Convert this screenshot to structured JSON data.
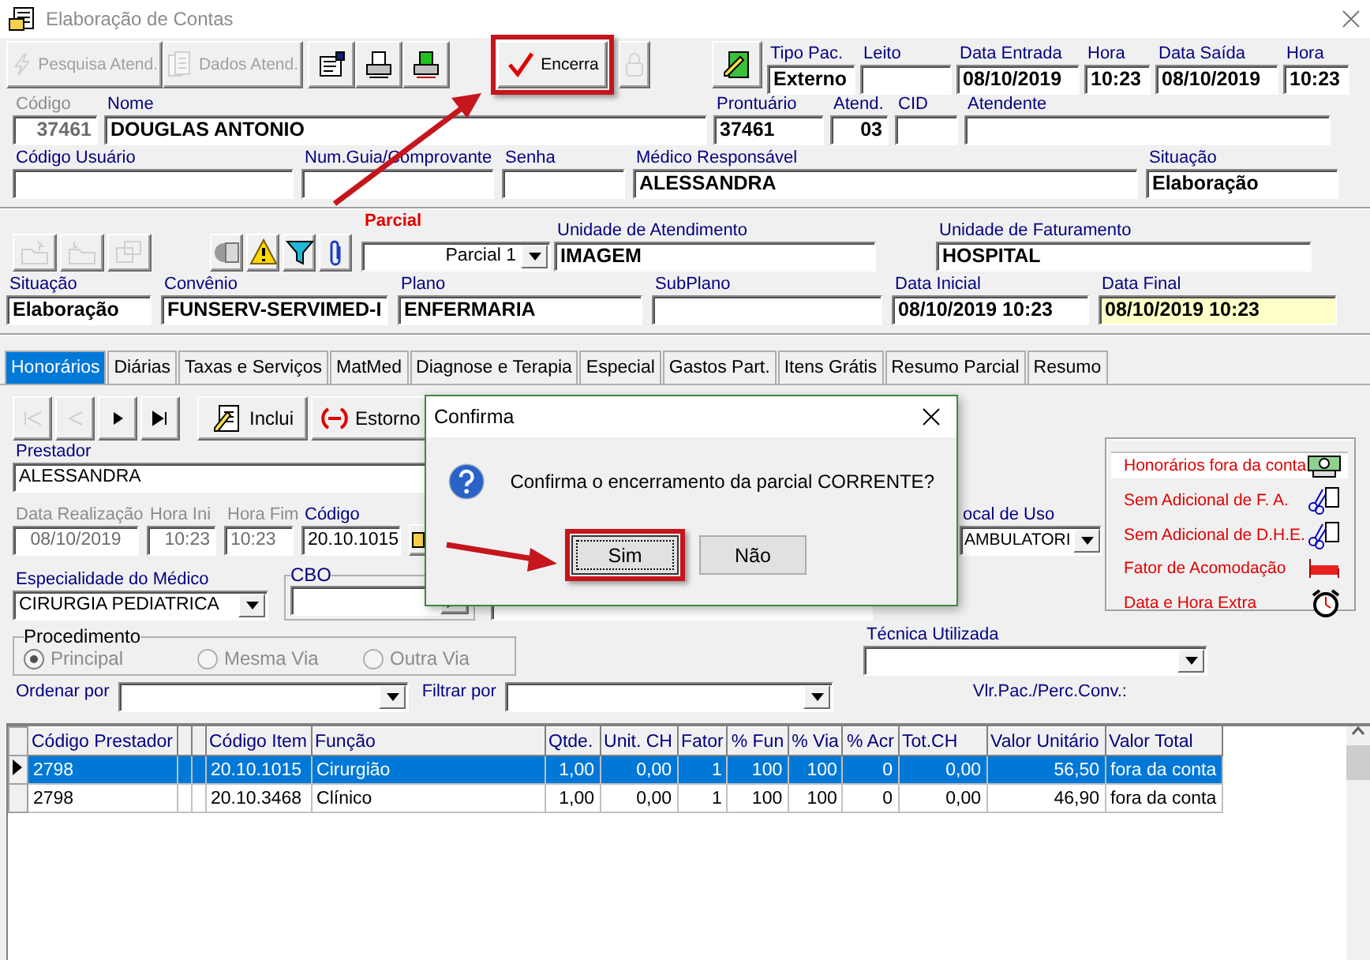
{
  "window": {
    "title": "Elaboração de Contas"
  },
  "toolbar": [
    {
      "kind": "search",
      "label": "Pesquisa Atend.",
      "disabled": true
    },
    {
      "kind": "documents",
      "label": "Dados Atend.",
      "disabled": true
    },
    {
      "kind": "properties",
      "disabled": false
    },
    {
      "kind": "printer",
      "disabled": false
    },
    {
      "kind": "printer-green",
      "disabled": false
    },
    {
      "kind": "check",
      "label": "Encerra",
      "disabled": false,
      "highlighted": true
    },
    {
      "kind": "lock",
      "disabled": true
    },
    {
      "kind": "edit-doc",
      "disabled": false
    }
  ],
  "header_rows": [
    [
      {
        "label": "Tipo Pac.",
        "value": "Externo"
      },
      {
        "label": "Leito"
      },
      {
        "label": "Data Entrada",
        "value": "08/10/2019"
      },
      {
        "label": "Hora",
        "value": "10:23"
      },
      {
        "label": "Data Saída",
        "value": "08/10/2019"
      },
      {
        "label": "Hora",
        "value": "10:23"
      }
    ],
    [
      {
        "label": "Código",
        "value": "37461",
        "disabled": true
      },
      {
        "label": "Nome",
        "value": "DOUGLAS ANTONIO",
        "disabled": false
      },
      {
        "label": "Prontuário",
        "value": "37461",
        "disabled": false
      },
      {
        "label": "Atend.",
        "value": "03",
        "disabled": false
      },
      {
        "label": "CID",
        "disabled": false
      },
      {
        "label": "Atendente",
        "disabled": false
      }
    ],
    [
      {
        "label": "Código Usuário"
      },
      {
        "label": "Num.Guia/Comprovante"
      },
      {
        "label": "Senha"
      },
      {
        "label": "Médico Responsável",
        "value": "ALESSANDRA"
      },
      {
        "label": "Situação",
        "value": "Elaboração"
      }
    ]
  ],
  "partial_tools": [
    {
      "kind": "folder-up",
      "disabled": true
    },
    {
      "kind": "folder-down",
      "disabled": true
    },
    {
      "kind": "windows",
      "disabled": true
    },
    {
      "kind": "gear-doc",
      "disabled": false
    },
    {
      "kind": "warning",
      "disabled": false
    },
    {
      "kind": "filter",
      "disabled": false
    },
    {
      "kind": "paperclip",
      "disabled": false
    }
  ],
  "parcial": {
    "label": "Parcial",
    "value": "Parcial 1"
  },
  "unidades": [
    {
      "label": "Unidade de Atendimento",
      "value": "IMAGEM"
    },
    {
      "label": "Unidade de Faturamento",
      "value": "HOSPITAL"
    }
  ],
  "account_row": [
    {
      "label": "Situação",
      "value": "Elaboração",
      "focused": false
    },
    {
      "label": "Convênio",
      "value": "FUNSERV-SERVIMED-I",
      "focused": false
    },
    {
      "label": "Plano",
      "value": "ENFERMARIA",
      "focused": false
    },
    {
      "label": "SubPlano",
      "focused": false
    },
    {
      "label": "Data Inicial",
      "value": "08/10/2019 10:23",
      "focused": false
    },
    {
      "label": "Data Final",
      "value": "08/10/2019 10:23",
      "focused": true
    }
  ],
  "tabs": [
    {
      "label": "Honorários",
      "selected": true
    },
    {
      "label": "Diárias",
      "selected": false
    },
    {
      "label": "Taxas e Serviços",
      "selected": false
    },
    {
      "label": "MatMed",
      "selected": false
    },
    {
      "label": "Diagnose e Terapia",
      "selected": false
    },
    {
      "label": "Especial",
      "selected": false
    },
    {
      "label": "Gastos Part.",
      "selected": false
    },
    {
      "label": "Itens Grátis",
      "selected": false
    },
    {
      "label": "Resumo Parcial",
      "selected": false
    },
    {
      "label": "Resumo",
      "selected": false
    }
  ],
  "nav": [
    {
      "kind": "first",
      "disabled": true
    },
    {
      "kind": "prev",
      "disabled": true
    },
    {
      "kind": "next",
      "disabled": false
    },
    {
      "kind": "last",
      "disabled": false
    },
    {
      "kind": "add",
      "label": "Inclui",
      "disabled": false
    },
    {
      "kind": "reverse",
      "label": "Estorno",
      "disabled": false
    }
  ],
  "prestador": {
    "label": "Prestador",
    "value": "ALESSANDRA"
  },
  "date_row": [
    {
      "label": "Data Realização",
      "value": "08/10/2019",
      "disabled": true
    },
    {
      "label": "Hora Ini",
      "value": "10:23",
      "disabled": true
    },
    {
      "label": "Hora Fim",
      "value": "10:23",
      "disabled": true
    },
    {
      "label": "Código",
      "value": "20.10.1015",
      "disabled": false
    }
  ],
  "local_de_uso": {
    "label": "ocal de Uso",
    "value": "AMBULATORI"
  },
  "especialidade": {
    "label": "Especialidade do Médico",
    "value": "CIRURGIA PEDIATRICA"
  },
  "cbo": {
    "label": "CBO"
  },
  "procedimento": {
    "label": "Procedimento",
    "disabled": true,
    "options": [
      {
        "label": "Principal",
        "selected": true
      },
      {
        "label": "Mesma Via",
        "selected": false
      },
      {
        "label": "Outra Via",
        "selected": false
      }
    ]
  },
  "tecnica": {
    "label": "Técnica Utilizada"
  },
  "ordenar": {
    "label": "Ordenar por"
  },
  "filtrar": {
    "label": "Filtrar por"
  },
  "vlr_label": "Vlr.Pac./Perc.Conv.:",
  "legend": [
    {
      "label": "Honorários fora da conta",
      "kind": "money",
      "selected": true
    },
    {
      "label": "Sem Adicional de F. A.",
      "kind": "scissors-doc",
      "selected": false
    },
    {
      "label": "Sem Adicional de D.H.E.",
      "kind": "scissors-doc",
      "selected": false
    },
    {
      "label": "Fator de Acomodação",
      "kind": "bed",
      "selected": false
    },
    {
      "label": "Data e Hora Extra",
      "kind": "alarm",
      "selected": false
    }
  ],
  "grid": {
    "columns": [
      "Código Prestador",
      "Código Item",
      "Função",
      "Qtde.",
      "Unit. CH",
      "Fator",
      "% Fun",
      "% Via",
      "% Acr",
      "Tot.CH",
      "Valor Unitário",
      "Valor Total"
    ],
    "rows": [
      {
        "selected": true,
        "cells": [
          "2798",
          "20.10.1015",
          "Cirurgião",
          "1,00",
          "0,00",
          "1",
          "100",
          "100",
          "0",
          "0,00",
          "56,50",
          "fora da conta"
        ]
      },
      {
        "selected": false,
        "cells": [
          "2798",
          "20.10.3468",
          "Clínico",
          "1,00",
          "0,00",
          "1",
          "100",
          "100",
          "0",
          "0,00",
          "46,90",
          "fora da conta"
        ]
      }
    ]
  },
  "dialog": {
    "title": "Confirma",
    "message": "Confirma o encerramento da parcial CORRENTE?",
    "buttons": [
      {
        "label": "Sim",
        "default": true,
        "highlighted": true
      },
      {
        "label": "Não",
        "default": false,
        "highlighted": false
      }
    ]
  }
}
